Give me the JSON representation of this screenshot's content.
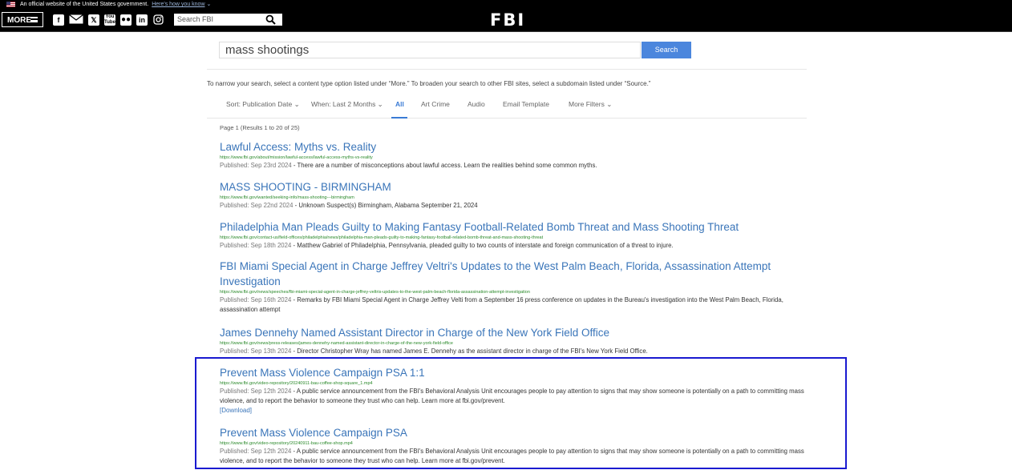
{
  "gov_banner": {
    "text": "An official website of the United States government.",
    "link": "Here's how you know"
  },
  "header": {
    "more_label": "MORE",
    "search_placeholder": "Search FBI",
    "logo": "FBI",
    "social_icons": [
      "facebook-icon",
      "email-icon",
      "x-icon",
      "youtube-icon",
      "flickr-icon",
      "linkedin-icon",
      "instagram-icon"
    ]
  },
  "search": {
    "query": "mass shootings",
    "button_label": "Search"
  },
  "hint": "To narrow your search, select a content type option listed under “More.” To broaden your search to other FBI sites, select a subdomain listed under “Source.”",
  "filters": {
    "sort": "Sort: Publication Date ⌄",
    "when": "When: Last 2 Months ⌄",
    "all": "All",
    "art_crime": "Art Crime",
    "audio": "Audio",
    "email_template": "Email Template",
    "more_filters": "More Filters ⌄"
  },
  "page_info": "Page 1 (Results 1 to 20 of 25)",
  "results": [
    {
      "title": "Lawful Access: Myths vs. Reality",
      "url": "https://www.fbi.gov/about/mission/lawful-access/lawful-access-myths-vs-reality",
      "published": "Published: Sep 23rd 2024",
      "summary": " - There are a number of misconceptions about lawful access. Learn the realities behind some common myths."
    },
    {
      "title": "MASS SHOOTING - BIRMINGHAM",
      "url": "https://www.fbi.gov/wanted/seeking-info/mass-shooting---birmingham",
      "published": "Published: Sep 22nd 2024",
      "summary": " - Unknown Suspect(s) Birmingham, Alabama September 21, 2024"
    },
    {
      "title": "Philadelphia Man Pleads Guilty to Making Fantasy Football-Related Bomb Threat and Mass Shooting Threat",
      "url": "https://www.fbi.gov/contact-us/field-offices/philadelphia/news/philadelphia-man-pleads-guilty-to-making-fantasy-football-related-bomb-threat-and-mass-shooting-threat",
      "published": "Published: Sep 18th 2024",
      "summary": " - Matthew Gabriel of Philadelphia, Pennsylvania, pleaded guilty to two counts of interstate and foreign communication of a threat to injure."
    },
    {
      "title": "FBI Miami Special Agent in Charge Jeffrey Veltri's Updates to the West Palm Beach, Florida, Assassination Attempt Investigation",
      "url": "https://www.fbi.gov/news/speeches/fbi-miami-special-agent-in-charge-jeffrey-veltris-updates-to-the-west-palm-beach-florida-assassination-attempt-investigation",
      "published": "Published: Sep 16th 2024",
      "summary": " - Remarks by FBI Miami Special Agent in Charge Jeffrey Velti from a September 16 press conference on updates in the Bureau's investigation into the West Palm Beach, Florida, assassination attempt"
    },
    {
      "title": "James Dennehy Named Assistant Director in Charge of the New York Field Office",
      "url": "https://www.fbi.gov/news/press-releases/james-dennehy-named-assistant-director-in-charge-of-the-new-york-field-office",
      "published": "Published: Sep 13th 2024",
      "summary": " - Director Christopher Wray has named James E. Dennehy as the assistant director in charge of the FBI's New York Field Office."
    },
    {
      "title": "Prevent Mass Violence Campaign PSA 1:1",
      "url": "https://www.fbi.gov/video-repository/20240911-bau-coffee-shop-square_1.mp4",
      "published": "Published: Sep 12th 2024",
      "summary": " - A public service announcement from the FBI's Behavioral Analysis Unit encourages people to pay attention to signs that may show someone is potentially on a path to committing mass violence, and to report the behavior to someone they trust who can help. Learn more at fbi.gov/prevent.",
      "download": "[Download]"
    },
    {
      "title": "Prevent Mass Violence Campaign PSA",
      "url": "https://www.fbi.gov/video-repository/20240911-bau-coffee-shop.mp4",
      "published": "Published: Sep 12th 2024",
      "summary": " - A public service announcement from the FBI's Behavioral Analysis Unit encourages people to pay attention to signs that may show someone is potentially on a path to committing mass violence, and to report the behavior to someone they trust who can help. Learn more at fbi.gov/prevent."
    }
  ]
}
